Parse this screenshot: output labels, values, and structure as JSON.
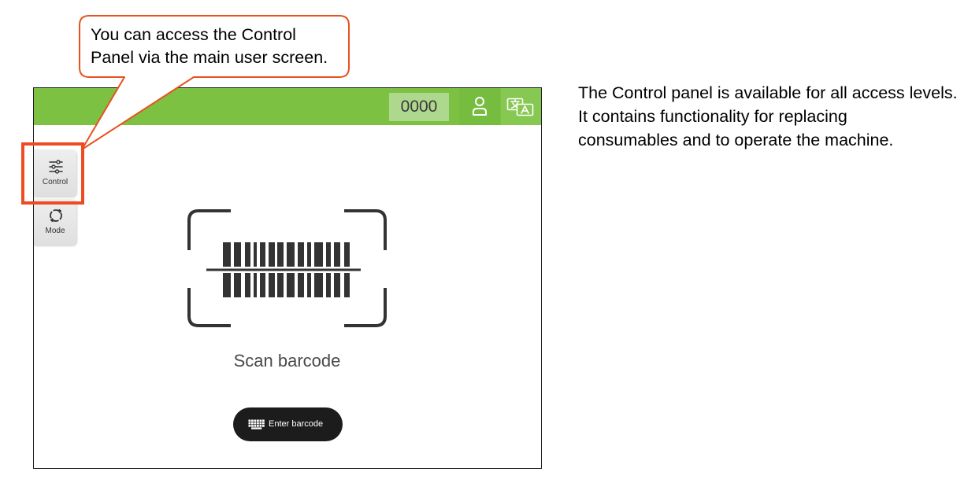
{
  "callout": {
    "lines": [
      "You can access the Control",
      "Panel via the main user screen."
    ]
  },
  "description": {
    "lines": [
      "The Control panel is available for all access levels.",
      "It contains functionality for replacing",
      "consumables and to operate the machine."
    ]
  },
  "device": {
    "header": {
      "counter": "0000",
      "user_icon": "user-icon",
      "language_icon": "translate-icon"
    },
    "sidebar": {
      "items": [
        {
          "label": "Control",
          "icon": "sliders-icon"
        },
        {
          "label": "Mode",
          "icon": "cycle-icon"
        }
      ]
    },
    "scan": {
      "icon": "barcode-scan-icon",
      "prompt": "Scan barcode"
    },
    "enter_button": {
      "label": "Enter barcode",
      "icon": "keyboard-icon"
    }
  },
  "colors": {
    "header_green": "#7cc142",
    "counter_background": "#aed88d",
    "highlight": "#ef4b23",
    "callout_border": "#e8511f",
    "button_dark": "#1c1c1c"
  }
}
